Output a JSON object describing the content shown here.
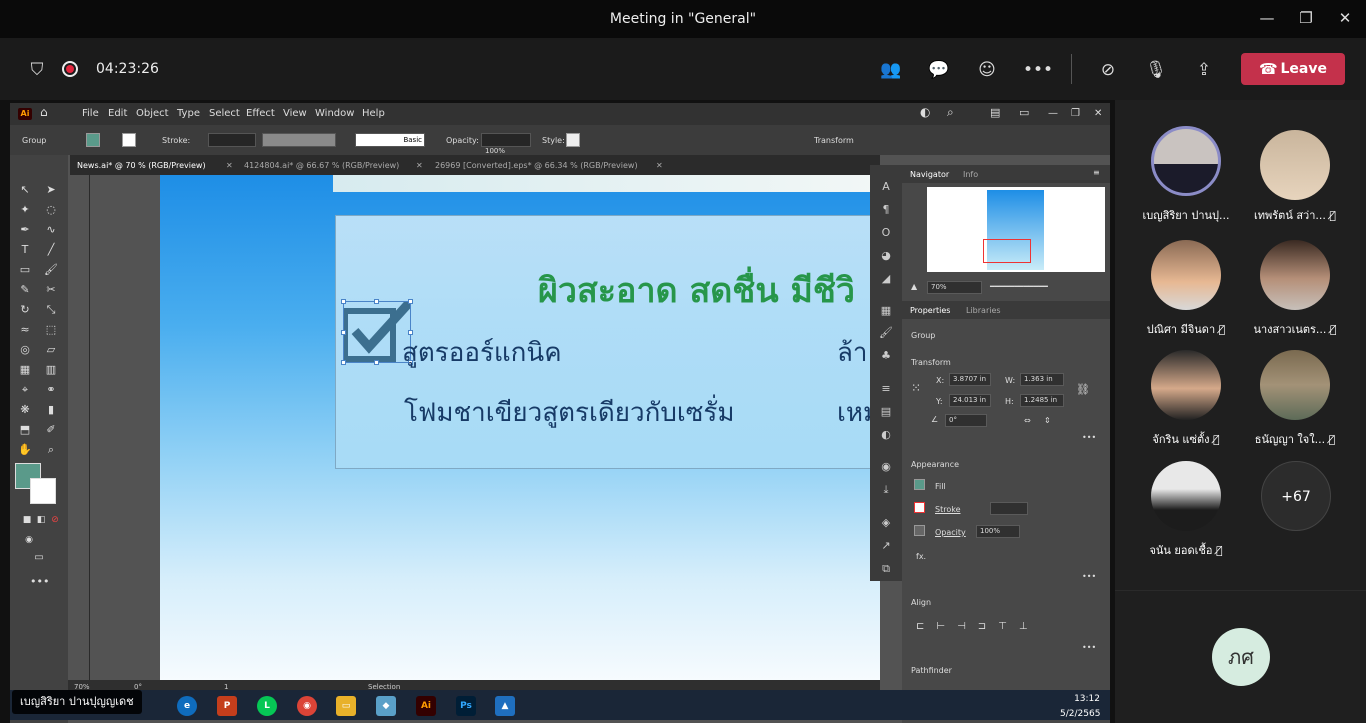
{
  "window": {
    "title": "Meeting in \"General\""
  },
  "meeting": {
    "timer": "04:23:26",
    "leave_label": "Leave"
  },
  "illustrator": {
    "menu": [
      "File",
      "Edit",
      "Object",
      "Type",
      "Select",
      "Effect",
      "View",
      "Window",
      "Help"
    ],
    "control": {
      "group_label": "Group",
      "stroke_label": "Stroke:",
      "basic_label": "Basic",
      "opacity_label": "Opacity:",
      "opacity_value": "100%",
      "style_label": "Style:",
      "transform_label": "Transform"
    },
    "tabs": [
      "News.ai* @ 70 % (RGB/Preview)",
      "4124804.ai* @ 66.67 % (RGB/Preview)",
      "26969 [Converted].eps* @ 66.34 % (RGB/Preview)"
    ],
    "artwork": {
      "headline": "ผิวสะอาด สดชื่น มีชีวิ",
      "line1": "สูตรออร์แกนิค",
      "line1_right": "ล้า",
      "line2": "โฟมชาเขียวสูตรเดียวกับเซรั่ม",
      "line2_right": "เหม"
    },
    "status": {
      "zoom": "70%",
      "rotation": "0°",
      "page": "1",
      "tool": "Selection"
    },
    "panels": {
      "navigator_tab": "Navigator",
      "info_tab": "Info",
      "nav_zoom": "70%",
      "properties_tab": "Properties",
      "libraries_tab": "Libraries",
      "group_label": "Group",
      "transform_label": "Transform",
      "x_label": "X:",
      "x_value": "3.8707 in",
      "y_label": "Y:",
      "y_value": "24.013 in",
      "w_label": "W:",
      "w_value": "1.363 in",
      "h_label": "H:",
      "h_value": "1.2485 in",
      "angle_value": "0°",
      "appearance_label": "Appearance",
      "fill_label": "Fill",
      "stroke_label": "Stroke",
      "opacity_label": "Opacity",
      "opacity_value": "100%",
      "fx_label": "fx.",
      "align_label": "Align",
      "pathfinder_label": "Pathfinder"
    }
  },
  "taskbar": {
    "time": "13:12",
    "date": "5/2/2565"
  },
  "presenter_name": "เบญสิริยา ปานปุญญเดช",
  "participants": [
    {
      "name": "เบญสิริยา ปานปุ...",
      "muted": false
    },
    {
      "name": "เทพรัตน์ สว่า...",
      "muted": true
    },
    {
      "name": "ปณิศา มีจินดา",
      "muted": true
    },
    {
      "name": "นางสาวเนตร...",
      "muted": true
    },
    {
      "name": "จักริน แซ่ตั้ง",
      "muted": true
    },
    {
      "name": "ธนัญญา ใจใ...",
      "muted": true
    },
    {
      "name": "จนัน ยอดเชื้อ",
      "muted": true
    }
  ],
  "more_count": "+67",
  "self_initials": "ภศ",
  "colors": {
    "leave": "#c4314b",
    "headline_green": "#27964a",
    "body_navy": "#173a66",
    "active_ring": "#8b8cc7"
  }
}
